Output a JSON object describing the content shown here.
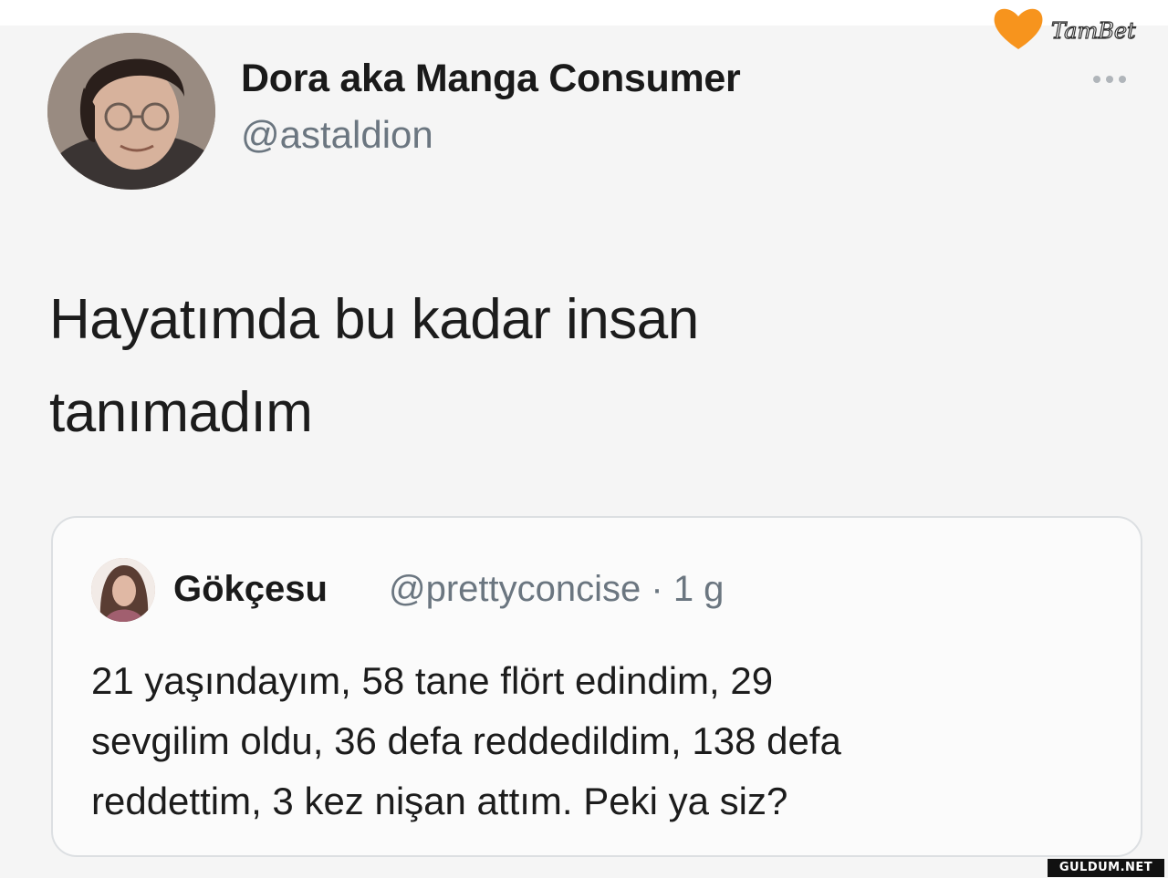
{
  "tweet": {
    "author": {
      "display_name": "Dora aka Manga Consumer",
      "handle": "@astaldion"
    },
    "text_line1": "Hayatımda bu kadar insan",
    "text_line2": "tanımadım",
    "more_icon": "more-horizontal-icon"
  },
  "quoted_tweet": {
    "author": {
      "display_name": "Gökçesu",
      "handle_and_time": "@prettyconcise · 1 g"
    },
    "text_line1": "21 yaşındayım, 58 tane flört edindim, 29",
    "text_line2": "sevgilim oldu, 36 defa reddedildim, 138 defa",
    "text_line3": "reddettim, 3 kez nişan attım. Peki ya siz?"
  },
  "watermarks": {
    "tambet": "TamBet",
    "guldum": "GULDUM.NET",
    "heart_color": "#f7941d"
  }
}
